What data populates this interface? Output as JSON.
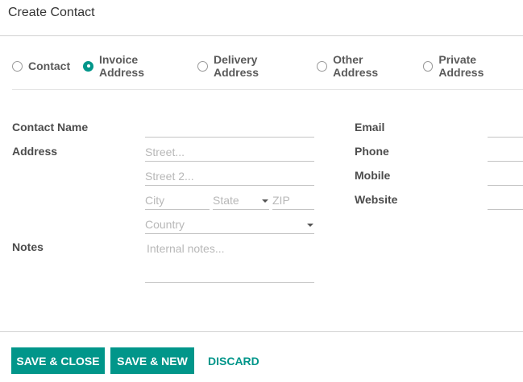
{
  "dialog": {
    "title": "Create Contact"
  },
  "address_types": [
    {
      "label": "Contact",
      "checked": false
    },
    {
      "label": "Invoice Address",
      "checked": true
    },
    {
      "label": "Delivery Address",
      "checked": false
    },
    {
      "label": "Other Address",
      "checked": false
    },
    {
      "label": "Private Address",
      "checked": false
    }
  ],
  "form": {
    "contact_name_label": "Contact Name",
    "address_label": "Address",
    "notes_label": "Notes",
    "email_label": "Email",
    "phone_label": "Phone",
    "mobile_label": "Mobile",
    "website_label": "Website",
    "street_placeholder": "Street...",
    "street2_placeholder": "Street 2...",
    "city_placeholder": "City",
    "state_placeholder": "State",
    "zip_placeholder": "ZIP",
    "country_placeholder": "Country",
    "notes_placeholder": "Internal notes..."
  },
  "footer": {
    "save_close_label": "SAVE & CLOSE",
    "save_new_label": "SAVE & NEW",
    "discard_label": "DISCARD"
  },
  "colors": {
    "accent": "#01968a"
  }
}
